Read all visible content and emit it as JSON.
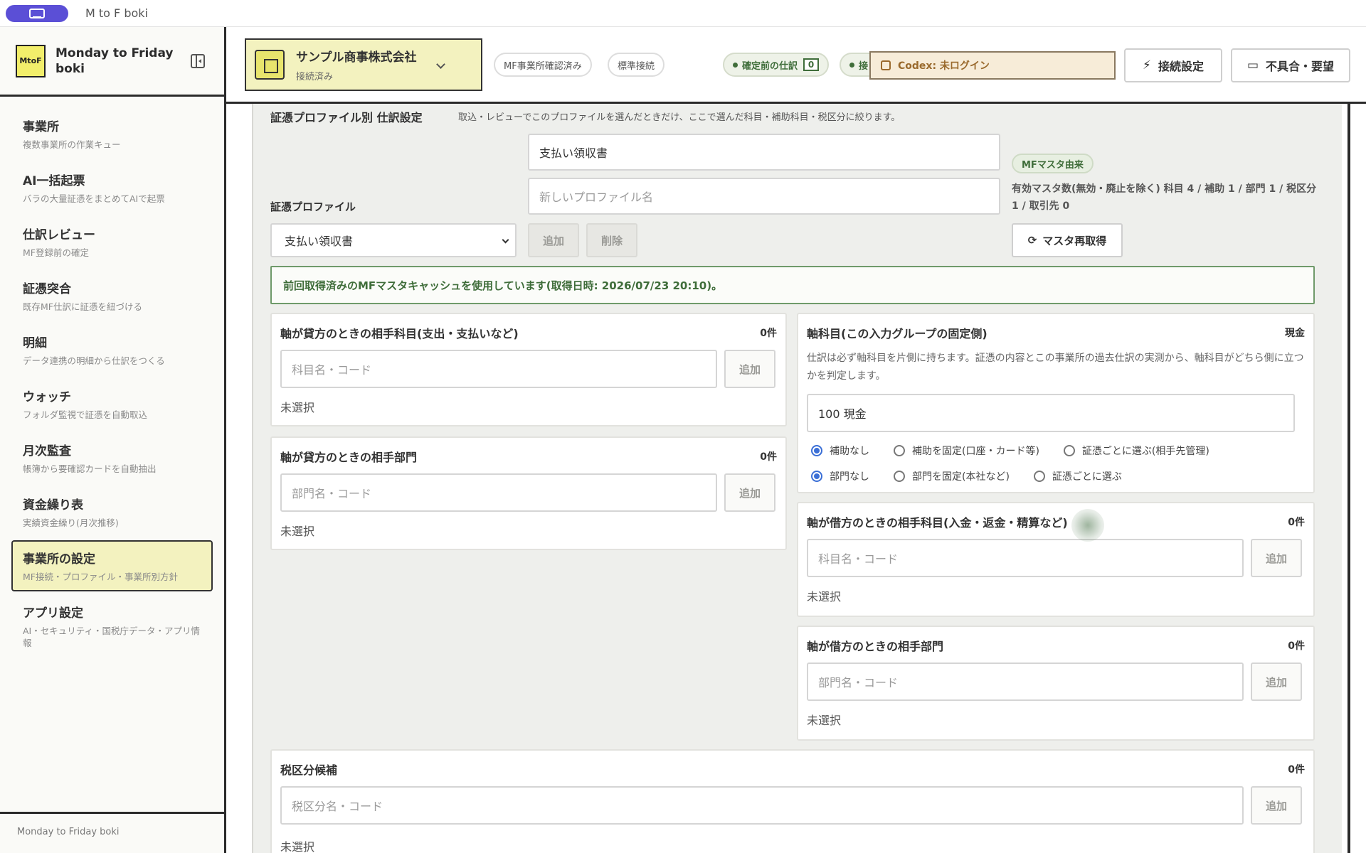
{
  "window": {
    "title": "M to F boki"
  },
  "sidebar": {
    "logo_text": "MtoF",
    "brand": "Monday to Friday boki",
    "items": [
      {
        "label": "事業所",
        "sub": "複数事業所の作業キュー"
      },
      {
        "label": "AI一括起票",
        "sub": "バラの大量証憑をまとめてAIで起票"
      },
      {
        "label": "仕訳レビュー",
        "sub": "MF登録前の確定"
      },
      {
        "label": "証憑突合",
        "sub": "既存MF仕訳に証憑を紐づける"
      },
      {
        "label": "明細",
        "sub": "データ連携の明細から仕訳をつくる"
      },
      {
        "label": "ウォッチ",
        "sub": "フォルダ監視で証憑を自動取込"
      },
      {
        "label": "月次監査",
        "sub": "帳簿から要確認カードを自動抽出"
      },
      {
        "label": "資金繰り表",
        "sub": "実績資金繰り(月次推移)"
      },
      {
        "label": "事業所の設定",
        "sub": "MF接続・プロファイル・事業所別方針"
      },
      {
        "label": "アプリ設定",
        "sub": "AI・セキュリティ・国税庁データ・アプリ情報"
      }
    ],
    "footer": "Monday to Friday boki"
  },
  "header": {
    "company_name": "サンプル商事株式会社",
    "company_status": "接続済み",
    "chip_mf_confirmed": "MF事業所確認済み",
    "chip_standard": "標準接続",
    "chip_pending_label": "確定前の仕訳",
    "chip_pending_count": "0",
    "chip_partial": "接",
    "codex_status": "Codex: 未ログイン",
    "connection_button": "接続設定",
    "feedback_button": "不具合・要望",
    "colors": {
      "accent": "#f3f2bf",
      "green": "#3f6d3a",
      "codex_bg": "#f7ecd8"
    }
  },
  "main": {
    "section_title": "証憑プロファイル別 仕訳設定",
    "section_desc": "取込・レビューでこのプロファイルを選んだときだけ、ここで選んだ科目・補助科目・税区分に絞ります。",
    "profile_name_value": "支払い領収書",
    "new_profile_placeholder": "新しいプロファイル名",
    "profile_label": "証憑プロファイル",
    "profile_select_value": "支払い領収書",
    "add_button": "追加",
    "delete_button": "削除",
    "mf_master_badge": "MFマスタ由来",
    "master_stats": "有効マスタ数(無効・廃止を除く) 科目 4 / 補助 1 / 部門 1 / 税区分 1 / 取引先 0",
    "refetch_button": "マスタ再取得",
    "notice": "前回取得済みのMFマスタキャッシュを使用しています(取得日時: 2026/07/23 20:10)。",
    "cards": {
      "credit_account": {
        "title": "軸が貸方のときの相手科目(支出・支払いなど)",
        "count": "0件",
        "placeholder": "科目名・コード",
        "add": "追加",
        "status": "未選択"
      },
      "credit_dept": {
        "title": "軸が貸方のときの相手部門",
        "count": "0件",
        "placeholder": "部門名・コード",
        "add": "追加",
        "status": "未選択"
      },
      "axis": {
        "title": "軸科目(この入力グループの固定側)",
        "badge": "現金",
        "desc": "仕訳は必ず軸科目を片側に持ちます。証憑の内容とこの事業所の過去仕訳の実測から、軸科目がどちら側に立つかを判定します。",
        "value": "100 現金",
        "sub_options": [
          "補助なし",
          "補助を固定(口座・カード等)",
          "証憑ごとに選ぶ(相手先管理)"
        ],
        "dept_options": [
          "部門なし",
          "部門を固定(本社など)",
          "証憑ごとに選ぶ"
        ]
      },
      "debit_account": {
        "title": "軸が借方のときの相手科目(入金・返金・精算など)",
        "count": "0件",
        "placeholder": "科目名・コード",
        "add": "追加",
        "status": "未選択"
      },
      "debit_dept": {
        "title": "軸が借方のときの相手部門",
        "count": "0件",
        "placeholder": "部門名・コード",
        "add": "追加",
        "status": "未選択"
      },
      "tax": {
        "title": "税区分候補",
        "count": "0件",
        "placeholder": "税区分名・コード",
        "add": "追加",
        "status": "未選択"
      }
    }
  }
}
